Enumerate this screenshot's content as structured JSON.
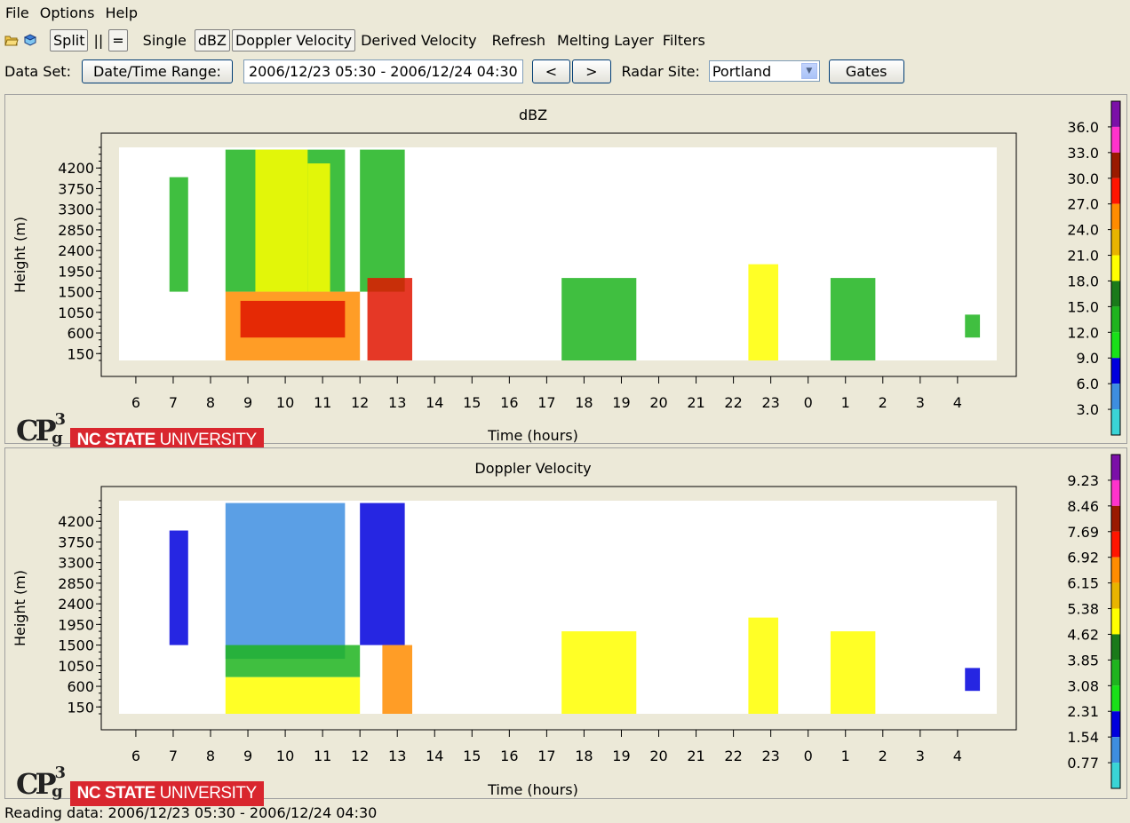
{
  "menubar": {
    "items": [
      "File",
      "Options",
      "Help"
    ]
  },
  "toolbar": {
    "split": "Split",
    "pause": "||",
    "equal": "=",
    "single": "Single",
    "dbz": "dBZ",
    "doppler": "Doppler Velocity",
    "derived": "Derived Velocity",
    "refresh": "Refresh",
    "melting": "Melting Layer",
    "filters": "Filters"
  },
  "dataset": {
    "label": "Data Set:",
    "range_button": "Date/Time Range:",
    "range_value": "2006/12/23 05:30 - 2006/12/24 04:30",
    "prev": "<",
    "next": ">",
    "radar_label": "Radar Site:",
    "radar_value": "Portland",
    "gates": "Gates"
  },
  "charts": [
    {
      "title": "dBZ",
      "ylabel": "Height (m)",
      "xlabel": "Time (hours)",
      "colorbar_labels": [
        "36.0",
        "33.0",
        "30.0",
        "27.0",
        "24.0",
        "21.0",
        "18.0",
        "15.0",
        "12.0",
        "9.0",
        "6.0",
        "3.0"
      ],
      "colorbar_colors": [
        "#7b10a8",
        "#ff33cc",
        "#9a1a00",
        "#ff1500",
        "#ff8c00",
        "#e8b400",
        "#ffff00",
        "#1a7a1a",
        "#1fb41f",
        "#19e019",
        "#0000dd",
        "#3e8ee0",
        "#3ad4d6"
      ]
    },
    {
      "title": "Doppler Velocity",
      "ylabel": "Height (m)",
      "xlabel": "Time (hours)",
      "colorbar_labels": [
        "9.23",
        "8.46",
        "7.69",
        "6.92",
        "6.15",
        "5.38",
        "4.62",
        "3.85",
        "3.08",
        "2.31",
        "1.54",
        "0.77"
      ],
      "colorbar_colors": [
        "#7b10a8",
        "#ff33cc",
        "#9a1a00",
        "#ff1500",
        "#ff8c00",
        "#e8b400",
        "#ffff00",
        "#1a7a1a",
        "#1fb41f",
        "#19e019",
        "#0000dd",
        "#3e8ee0",
        "#3ad4d6"
      ]
    }
  ],
  "chart_data": [
    {
      "type": "heatmap",
      "title": "dBZ",
      "xlabel": "Time (hours)",
      "ylabel": "Height (m)",
      "x_ticks": [
        "6",
        "7",
        "8",
        "9",
        "10",
        "11",
        "12",
        "13",
        "14",
        "15",
        "16",
        "17",
        "18",
        "19",
        "20",
        "21",
        "22",
        "23",
        "0",
        "1",
        "2",
        "3",
        "4"
      ],
      "y_ticks": [
        "150",
        "600",
        "1050",
        "1500",
        "1950",
        "2400",
        "2850",
        "3300",
        "3750",
        "4200"
      ],
      "colorbar": [
        "3.0",
        "6.0",
        "9.0",
        "12.0",
        "15.0",
        "18.0",
        "21.0",
        "24.0",
        "27.0",
        "30.0",
        "33.0",
        "36.0"
      ],
      "blobs": [
        {
          "x": [
            5.95,
            7.2
          ],
          "y": [
            1500,
            4000
          ],
          "level": "green"
        },
        {
          "x": [
            7.7,
            11.3
          ],
          "y": [
            1500,
            4600
          ],
          "level": "green"
        },
        {
          "x": [
            8.6,
            9.8
          ],
          "y": [
            1500,
            4600
          ],
          "level": "yellow"
        },
        {
          "x": [
            10.3,
            11.1
          ],
          "y": [
            1500,
            4300
          ],
          "level": "yellow"
        },
        {
          "x": [
            7.7,
            11.5
          ],
          "y": [
            0,
            1500
          ],
          "level": "orange"
        },
        {
          "x": [
            7.9,
            11.3
          ],
          "y": [
            500,
            1300
          ],
          "level": "red"
        },
        {
          "x": [
            11.5,
            13.1
          ],
          "y": [
            1500,
            4600
          ],
          "level": "green"
        },
        {
          "x": [
            12.1,
            13.2
          ],
          "y": [
            0,
            1800
          ],
          "level": "red"
        },
        {
          "x": [
            17.2,
            18.7
          ],
          "y": [
            0,
            1800
          ],
          "level": "green"
        },
        {
          "x": [
            22.2,
            22.6
          ],
          "y": [
            0,
            2100
          ],
          "level": "yellow"
        },
        {
          "x": [
            0.3,
            0.9
          ],
          "y": [
            0,
            1800
          ],
          "level": "green"
        },
        {
          "x": [
            3.8,
            4.1
          ],
          "y": [
            500,
            1000
          ],
          "level": "green"
        }
      ]
    },
    {
      "type": "heatmap",
      "title": "Doppler Velocity",
      "xlabel": "Time (hours)",
      "ylabel": "Height (m)",
      "x_ticks": [
        "6",
        "7",
        "8",
        "9",
        "10",
        "11",
        "12",
        "13",
        "14",
        "15",
        "16",
        "17",
        "18",
        "19",
        "20",
        "21",
        "22",
        "23",
        "0",
        "1",
        "2",
        "3",
        "4"
      ],
      "y_ticks": [
        "150",
        "600",
        "1050",
        "1500",
        "1950",
        "2400",
        "2850",
        "3300",
        "3750",
        "4200"
      ],
      "colorbar": [
        "0.77",
        "1.54",
        "2.31",
        "3.08",
        "3.85",
        "4.62",
        "5.38",
        "6.15",
        "6.92",
        "7.69",
        "8.46",
        "9.23"
      ],
      "blobs": [
        {
          "x": [
            5.95,
            7.2
          ],
          "y": [
            1500,
            4000
          ],
          "level": "blue"
        },
        {
          "x": [
            7.7,
            11.3
          ],
          "y": [
            1200,
            4600
          ],
          "level": "light-blue"
        },
        {
          "x": [
            7.7,
            11.5
          ],
          "y": [
            800,
            1500
          ],
          "level": "green"
        },
        {
          "x": [
            7.7,
            11.5
          ],
          "y": [
            0,
            800
          ],
          "level": "yellow"
        },
        {
          "x": [
            11.5,
            13.1
          ],
          "y": [
            1500,
            4600
          ],
          "level": "blue"
        },
        {
          "x": [
            11.8,
            13.2
          ],
          "y": [
            0,
            1500
          ],
          "level": "orange"
        },
        {
          "x": [
            17.2,
            18.7
          ],
          "y": [
            0,
            1800
          ],
          "level": "yellow"
        },
        {
          "x": [
            22.2,
            22.6
          ],
          "y": [
            0,
            2100
          ],
          "level": "yellow"
        },
        {
          "x": [
            0.3,
            0.9
          ],
          "y": [
            0,
            1800
          ],
          "level": "yellow"
        },
        {
          "x": [
            3.8,
            4.1
          ],
          "y": [
            500,
            1000
          ],
          "level": "blue"
        }
      ]
    }
  ],
  "logos": {
    "cpg": "CPg3",
    "ncsu_bold": "NC STATE",
    "ncsu_light": "UNIVERSITY"
  },
  "status": "Reading data: 2006/12/23 05:30 - 2006/12/24 04:30"
}
